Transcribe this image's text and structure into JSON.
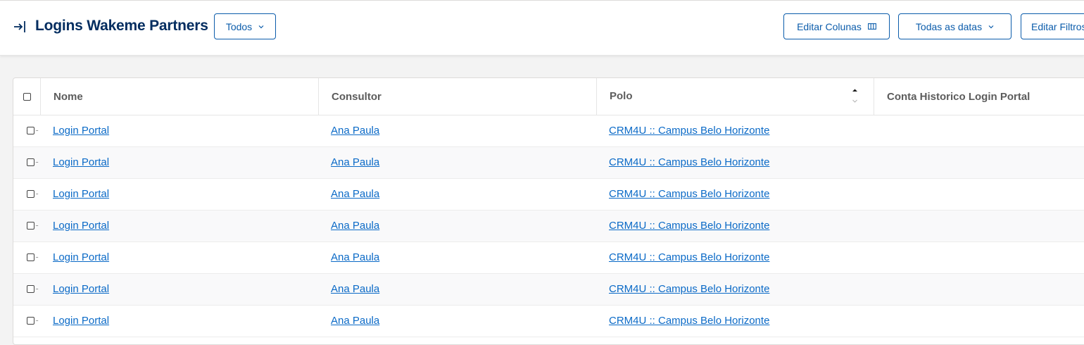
{
  "header": {
    "title": "Logins Wakeme Partners",
    "filter_label": "Todos",
    "edit_columns_label": "Editar Colunas",
    "dates_label": "Todas as datas",
    "edit_filters_label": "Editar Filtros"
  },
  "table": {
    "columns": {
      "nome": "Nome",
      "consultor": "Consultor",
      "polo": "Polo",
      "conta": "Conta Historico Login Portal"
    },
    "rows": [
      {
        "nome": "Login Portal",
        "consultor": "Ana Paula",
        "polo": "CRM4U :: Campus Belo Horizonte",
        "conta": ""
      },
      {
        "nome": "Login Portal",
        "consultor": "Ana Paula",
        "polo": "CRM4U :: Campus Belo Horizonte",
        "conta": ""
      },
      {
        "nome": "Login Portal",
        "consultor": "Ana Paula",
        "polo": "CRM4U :: Campus Belo Horizonte",
        "conta": ""
      },
      {
        "nome": "Login Portal",
        "consultor": "Ana Paula",
        "polo": "CRM4U :: Campus Belo Horizonte",
        "conta": ""
      },
      {
        "nome": "Login Portal",
        "consultor": "Ana Paula",
        "polo": "CRM4U :: Campus Belo Horizonte",
        "conta": ""
      },
      {
        "nome": "Login Portal",
        "consultor": "Ana Paula",
        "polo": "CRM4U :: Campus Belo Horizonte",
        "conta": ""
      },
      {
        "nome": "Login Portal",
        "consultor": "Ana Paula",
        "polo": "CRM4U :: Campus Belo Horizonte",
        "conta": ""
      }
    ]
  },
  "icons": {
    "title": "login-icon",
    "filter_chevron": "chevron-down-icon",
    "columns": "columns-icon",
    "dates_chevron": "chevron-down-icon",
    "sort": "sort-ascending-icon"
  },
  "colors": {
    "brand": "#0b5cab",
    "title": "#032d60",
    "link": "#0b6ac7"
  }
}
